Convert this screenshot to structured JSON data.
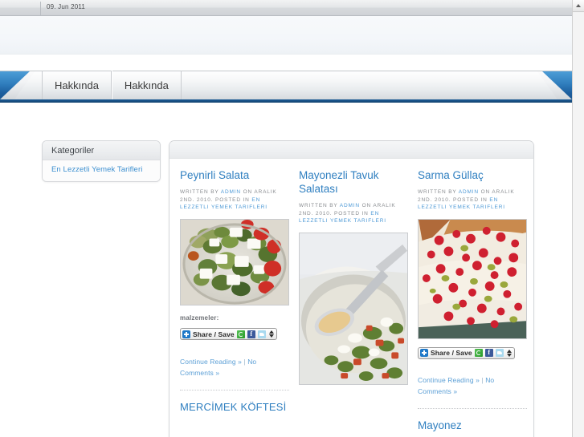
{
  "browser": {
    "tab_date": "09. Jun 2011",
    "scrollbar_up_icon": "triangle-up-icon"
  },
  "nav": {
    "items": [
      {
        "label": "Hakkında"
      },
      {
        "label": "Hakkında"
      }
    ]
  },
  "sidebar": {
    "widget_title": "Kategoriler",
    "links": [
      {
        "label": "En Lezzetli Yemek Tarifleri"
      }
    ]
  },
  "share_widget": {
    "label": "Share / Save",
    "plus_icon": "plus-icon",
    "sharethis_icon": "sharethis-icon",
    "facebook_icon": "facebook-icon",
    "facebook_glyph": "f",
    "twitter_icon": "twitter-icon",
    "updown_icon": "up-down-arrows-icon"
  },
  "posts": {
    "col1": [
      {
        "title": "Peynirli Salata",
        "meta_prefix": "Written by ",
        "meta_author": "admin",
        "meta_mid": " on Aralık 2nd. 2010. Posted in ",
        "meta_category": "En Lezzetli Yemek Tarifleri",
        "image_alt": "peynirli-salata-photo",
        "ingredients_label": "malzemeler:",
        "read_more": "Continue Reading »",
        "separator": " | ",
        "comments": "No Comments »"
      },
      {
        "title": "MERCİMEK KÖFTESİ"
      }
    ],
    "col2": [
      {
        "title": "Mayonezli Tavuk Salatası",
        "meta_prefix": "Written by ",
        "meta_author": "admin",
        "meta_mid": " on Aralık 2nd. 2010. Posted in ",
        "meta_category": "En Lezzetli Yemek Tarifleri",
        "image_alt": "mayonezli-tavuk-salatasi-photo"
      }
    ],
    "col3": [
      {
        "title": "Sarma Güllaç",
        "meta_prefix": "Written by ",
        "meta_author": "admin",
        "meta_mid": " on Aralık 2nd. 2010. Posted in ",
        "meta_category": "En Lezzetli Yemek Tarifleri",
        "image_alt": "sarma-gullac-photo",
        "read_more": "Continue Reading »",
        "separator": " | ",
        "comments": "No Comments »"
      },
      {
        "title": "Mayonez"
      }
    ]
  },
  "colors": {
    "link_blue": "#3c8fd0",
    "title_blue": "#2f7fc0",
    "nav_blue": "#2f7dbd",
    "meta_grey": "#8a8d91"
  }
}
